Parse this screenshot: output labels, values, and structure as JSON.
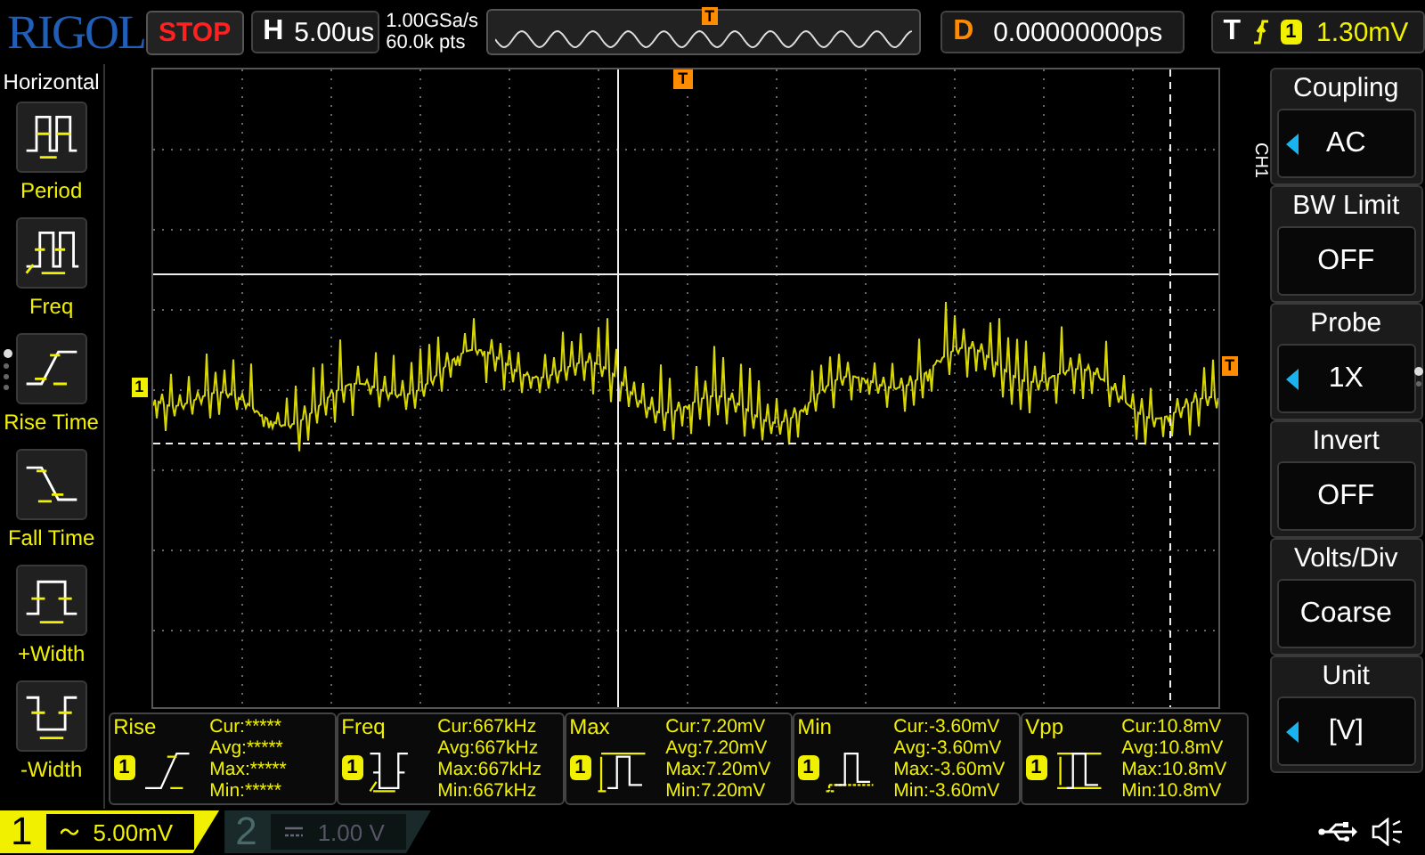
{
  "brand": "RIGOL",
  "run_state": "STOP",
  "timebase": {
    "label": "H",
    "value": "5.00us"
  },
  "sample": {
    "rate": "1.00GSa/s",
    "points": "60.0k pts"
  },
  "overview": {
    "marker": "T"
  },
  "delay": {
    "label": "D",
    "value": "0.00000000ps"
  },
  "trigger": {
    "label": "T",
    "channel": "1",
    "level": "1.30mV"
  },
  "left_menu": {
    "title": "Horizontal",
    "items": [
      {
        "label": "Period",
        "kind": "period"
      },
      {
        "label": "Freq",
        "kind": "freq"
      },
      {
        "label": "Rise Time",
        "kind": "rise"
      },
      {
        "label": "Fall Time",
        "kind": "fall"
      },
      {
        "label": "+Width",
        "kind": "pwidth"
      },
      {
        "label": "-Width",
        "kind": "nwidth"
      }
    ],
    "pages": [
      {
        "selected": true
      },
      {
        "selected": false
      },
      {
        "selected": false
      },
      {
        "selected": false
      }
    ]
  },
  "screen": {
    "trigger_position": "T",
    "channel_marker": "1",
    "trigger_level": "T"
  },
  "right_menu": {
    "channel": "CH1",
    "items": [
      {
        "title": "Coupling",
        "value": "AC",
        "adjustable": true
      },
      {
        "title": "BW Limit",
        "value": "OFF",
        "adjustable": false
      },
      {
        "title": "Probe",
        "value": "1X",
        "adjustable": true
      },
      {
        "title": "Invert",
        "value": "OFF",
        "adjustable": false
      },
      {
        "title": "Volts/Div",
        "value": "Coarse",
        "adjustable": false
      },
      {
        "title": "Unit",
        "value": "[V]",
        "adjustable": true
      }
    ],
    "pages": [
      {
        "selected": true
      },
      {
        "selected": false
      }
    ]
  },
  "measurements": [
    {
      "name": "Rise",
      "channel": "1",
      "kind": "rise",
      "lines": [
        "Cur:*****",
        "Avg:*****",
        "Max:*****",
        "Min:*****"
      ]
    },
    {
      "name": "Freq",
      "channel": "1",
      "kind": "freq",
      "lines": [
        "Cur:667kHz",
        "Avg:667kHz",
        "Max:667kHz",
        "Min:667kHz"
      ]
    },
    {
      "name": "Max",
      "channel": "1",
      "kind": "max",
      "lines": [
        "Cur:7.20mV",
        "Avg:7.20mV",
        "Max:7.20mV",
        "Min:7.20mV"
      ]
    },
    {
      "name": "Min",
      "channel": "1",
      "kind": "min",
      "lines": [
        "Cur:-3.60mV",
        "Avg:-3.60mV",
        "Max:-3.60mV",
        "Min:-3.60mV"
      ]
    },
    {
      "name": "Vpp",
      "channel": "1",
      "kind": "vpp",
      "lines": [
        "Cur:10.8mV",
        "Avg:10.8mV",
        "Max:10.8mV",
        "Min:10.8mV"
      ]
    }
  ],
  "channels": [
    {
      "number": "1",
      "kind": "ac",
      "scale": "5.00mV",
      "on": true
    },
    {
      "number": "2",
      "kind": "dc",
      "scale": "1.00 V",
      "on": false
    }
  ]
}
